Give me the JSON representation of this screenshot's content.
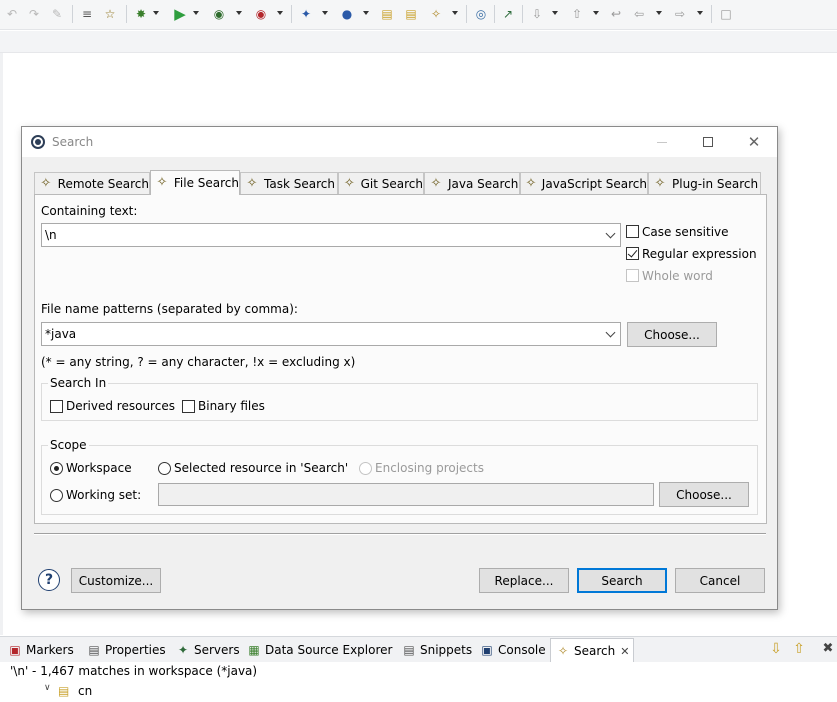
{
  "toolbar": {
    "icons": [
      "back-history-icon",
      "forward-history-icon",
      "last-edit-icon",
      "toggle-comment-icon",
      "open-task-icon",
      "debug-icon",
      "run-icon",
      "run-external-icon",
      "coverage-icon",
      "new-icon",
      "open-type-icon",
      "open-folder-icon",
      "open-perspective-icon",
      "search-icon",
      "web-browser-icon",
      "jump-icon",
      "next-annotation-icon",
      "previous-annotation-icon",
      "back-icon",
      "forward-icon",
      "pin-editor-icon"
    ]
  },
  "dialog": {
    "title": "Search",
    "tabs": [
      {
        "label": "Remote Search",
        "icon": "remote-search-icon"
      },
      {
        "label": "File Search",
        "icon": "file-search-icon"
      },
      {
        "label": "Task Search",
        "icon": "task-search-icon"
      },
      {
        "label": "Git Search",
        "icon": "git-search-icon"
      },
      {
        "label": "Java Search",
        "icon": "java-search-icon"
      },
      {
        "label": "JavaScript Search",
        "icon": "javascript-search-icon"
      },
      {
        "label": "Plug-in Search",
        "icon": "plugin-search-icon"
      }
    ],
    "active_tab": "File Search",
    "containing_text_label": "Containing text:",
    "containing_text_value": "\\n",
    "case_sensitive_label": "Case sensitive",
    "case_sensitive": false,
    "regex_label": "Regular expression",
    "regex": true,
    "whole_word_label": "Whole word",
    "whole_word": false,
    "file_patterns_label": "File name patterns (separated by comma):",
    "file_patterns_value": "*java",
    "choose_label": "Choose...",
    "patterns_hint": "(* = any string, ? = any character, !x = excluding x)",
    "search_in_title": "Search In",
    "derived_resources_label": "Derived resources",
    "binary_files_label": "Binary files",
    "scope_title": "Scope",
    "scope_workspace_label": "Workspace",
    "scope_selected_label": "Selected resource in 'Search'",
    "scope_enclosing_label": "Enclosing projects",
    "scope_working_set_label": "Working set:",
    "scope_working_set_value": "",
    "scope_selected": "Workspace",
    "customize_label": "Customize...",
    "replace_label": "Replace...",
    "search_label": "Search",
    "cancel_label": "Cancel",
    "help_glyph": "?"
  },
  "views": {
    "tabs": [
      {
        "label": "Markers",
        "icon": "markers-icon"
      },
      {
        "label": "Properties",
        "icon": "properties-icon"
      },
      {
        "label": "Servers",
        "icon": "servers-icon"
      },
      {
        "label": "Data Source Explorer",
        "icon": "data-source-icon"
      },
      {
        "label": "Snippets",
        "icon": "snippets-icon"
      },
      {
        "label": "Console",
        "icon": "console-icon"
      },
      {
        "label": "Search",
        "icon": "search-view-icon"
      }
    ],
    "active_tab": "Search",
    "result_summary": "'\\n' - 1,467 matches in workspace (*java)",
    "tree_item": "cn"
  },
  "colors": {
    "default_button_border": "#0078d7",
    "toolbar_bg": "#f5f6f7",
    "dialog_bg": "#f0f0f0"
  }
}
